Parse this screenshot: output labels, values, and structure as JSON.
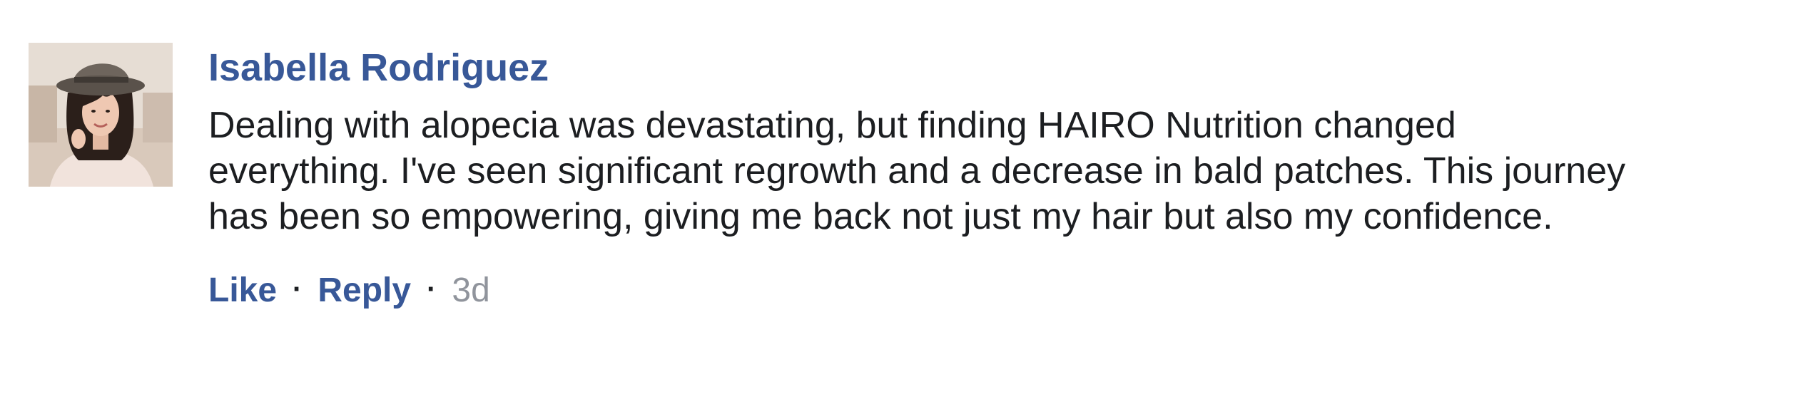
{
  "comment": {
    "author": "Isabella Rodriguez",
    "text": "Dealing with alopecia was devastating, but finding HAIRO Nutrition changed everything. I've seen significant regrowth and a decrease in bald patches. This journey has been so empowering, giving me back not just my hair but also my confidence.",
    "actions": {
      "like_label": "Like",
      "reply_label": "Reply",
      "separator": "·",
      "timestamp": "3d"
    }
  },
  "colors": {
    "link": "#385898",
    "text": "#1c1e21",
    "muted": "#90949c"
  },
  "icons": {
    "avatar": "profile-photo"
  }
}
